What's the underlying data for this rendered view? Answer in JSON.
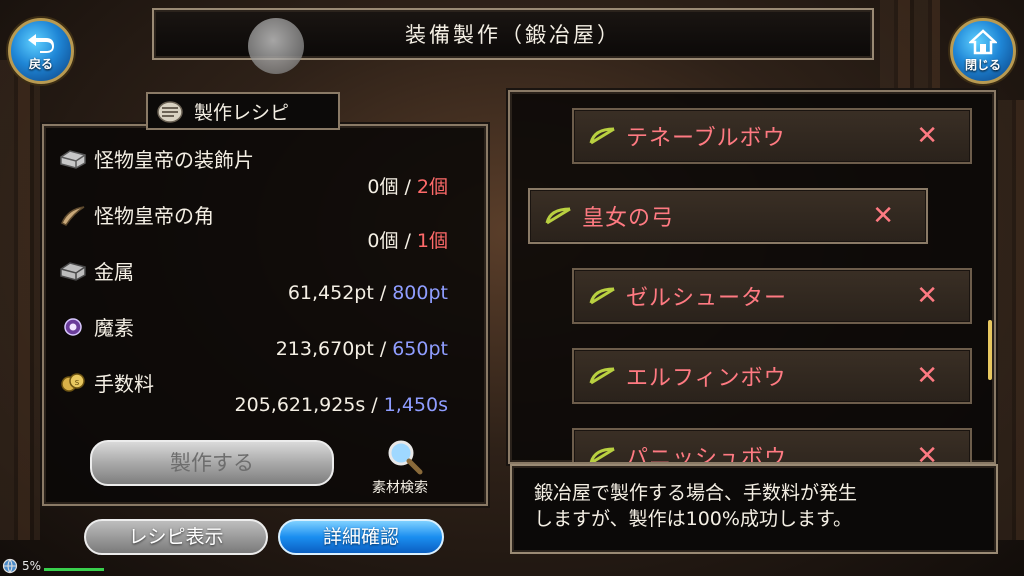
{
  "header": {
    "title": "装備製作（鍛冶屋）",
    "back_label": "戻る",
    "close_label": "閉じる"
  },
  "recipe_panel": {
    "title": "製作レシピ",
    "materials": [
      {
        "name": "怪物皇帝の装飾片",
        "have": "0個",
        "need": "2個",
        "need_color": "red",
        "icon": "silver-ingot-icon"
      },
      {
        "name": "怪物皇帝の角",
        "have": "0個",
        "need": "1個",
        "need_color": "red",
        "icon": "horn-icon"
      },
      {
        "name": "金属",
        "have": "61,452pt",
        "need": "800pt",
        "need_color": "blue",
        "icon": "metal-ingot-icon"
      },
      {
        "name": "魔素",
        "have": "213,670pt",
        "need": "650pt",
        "need_color": "blue",
        "icon": "mana-orb-icon"
      },
      {
        "name": "手数料",
        "have": "205,621,925s",
        "need": "1,450s",
        "need_color": "blue",
        "icon": "coins-icon"
      }
    ],
    "separator": "/",
    "craft_button": "製作する",
    "search_label": "素材検索"
  },
  "bottom_buttons": {
    "show_recipe": "レシピ表示",
    "detail_confirm": "詳細確認"
  },
  "recipe_list": [
    {
      "name": "テネーブルボウ",
      "mark": "✕",
      "selected": false
    },
    {
      "name": "皇女の弓",
      "mark": "✕",
      "selected": true
    },
    {
      "name": "ゼルシューター",
      "mark": "✕",
      "selected": false
    },
    {
      "name": "エルフィンボウ",
      "mark": "✕",
      "selected": false
    },
    {
      "name": "パニッシュボウ",
      "mark": "✕",
      "selected": false
    }
  ],
  "info": {
    "line1": "鍛冶屋で製作する場合、手数料が発生",
    "line2": "しますが、製作は100%成功します。"
  },
  "status": {
    "percent": "5%"
  },
  "colors": {
    "need_red": "#ff6a6a",
    "need_blue": "#8f9dff",
    "recipe_name": "#ff7a82",
    "button_blue": "#1a8ef0"
  }
}
